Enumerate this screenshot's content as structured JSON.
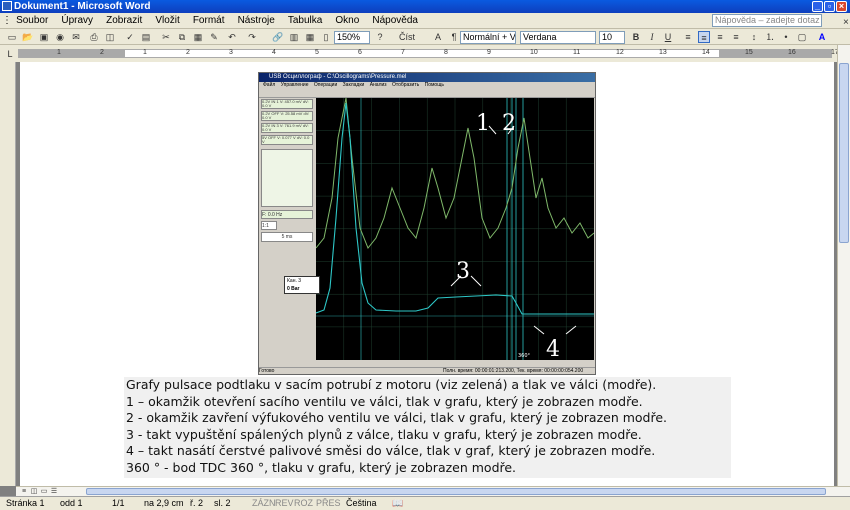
{
  "window": {
    "title": "Dokument1 - Microsoft Word"
  },
  "menu": [
    "Soubor",
    "Úpravy",
    "Zobrazit",
    "Vložit",
    "Formát",
    "Nástroje",
    "Tabulka",
    "Okno",
    "Nápověda"
  ],
  "help_placeholder": "Nápověda – zadejte dotaz",
  "toolbar": {
    "zoom": "150%",
    "read": "Číst",
    "style": "Normální + Verd",
    "font": "Verdana",
    "size": "10",
    "bold": "B",
    "italic": "I",
    "underline": "U"
  },
  "ruler_numbers": [
    "1",
    "2",
    "1",
    "2",
    "3",
    "4",
    "5",
    "6",
    "7",
    "8",
    "9",
    "10",
    "11",
    "12",
    "13",
    "14",
    "15",
    "16",
    "17",
    "18"
  ],
  "oscilloscope": {
    "title": "USB Осциллограф - C:\\Oscillograms\\Pressure.mel",
    "menu": [
      "Файл",
      "Управление",
      "Операции",
      "Закладки",
      "Анализ",
      "Отобразить",
      "Помощь"
    ],
    "channels": [
      {
        "name": "0.2V IN 1",
        "val": "V: 457.0 mV",
        "val2": "dV: 0.0 V"
      },
      {
        "name": "0.2V OFF",
        "val": "V: 25.58 mV",
        "val2": "dV: 0.0 V"
      },
      {
        "name": "0.2V IN 3",
        "val": "V: 761.9 mV",
        "val2": "dV: 0.0 V"
      },
      {
        "name": "5V OFF",
        "val": "V: 0.077 V",
        "val2": "dV: 0.0 V"
      }
    ],
    "timebase": "5 ms",
    "scale": "1:1",
    "freq": "F: 0.0 Hz",
    "status_left": "Готово",
    "status_right": "Полн. время: 00:00:01:213.200, Тек. время: 00:00:00:054.200",
    "tooltip_title": "Кан. 3",
    "tooltip_value": "0 Bar",
    "labels": [
      "1",
      "2",
      "3",
      "4"
    ],
    "marker_deg": "360°"
  },
  "caption": [
    "Grafy pulsace podtlaku v sacím potrubí z motoru (viz zelená) a tlak ve válci (modře).",
    "1 – okamžik otevření sacího ventilu ve válci, tlak v grafu, který je zobrazen modře.",
    "2 - okamžik zavření výfukového ventilu ve válci, tlak v grafu, který je zobrazen modře.",
    "3 - takt vypuštění spálených plynů z válce, tlaku v grafu, který je zobrazen modře.",
    "4 – takt nasátí čerstvé palivové směsi do válce, tlak v graf, který je zobrazen modře.",
    "360 ° -  bod TDC 360 °, tlaku v grafu, který je zobrazen modře."
  ],
  "status": {
    "page": "Stránka 1",
    "section": "odd 1",
    "pages": "1/1",
    "pos": "na 2,9 cm",
    "line": "ř. 2",
    "col": "sl. 2",
    "rec": "ZÁZN",
    "rev": "REV",
    "ext": "ROZ",
    "ovr": "PŘES",
    "lang": "Čeština"
  }
}
